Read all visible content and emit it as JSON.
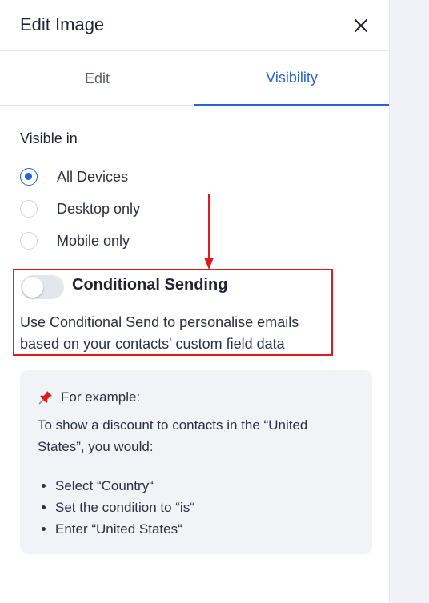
{
  "header": {
    "title": "Edit Image"
  },
  "tabs": [
    {
      "label": "Edit",
      "active": false
    },
    {
      "label": "Visibility",
      "active": true
    }
  ],
  "visibility": {
    "section_label": "Visible in",
    "options": [
      {
        "label": "All Devices",
        "selected": true
      },
      {
        "label": "Desktop only",
        "selected": false
      },
      {
        "label": "Mobile only",
        "selected": false
      }
    ]
  },
  "conditional": {
    "toggle_on": false,
    "title": "Conditional Sending",
    "description": "Use Conditional Send to personalise emails based on your contacts' custom field data"
  },
  "example": {
    "icon": "pushpin-icon",
    "heading": "For example:",
    "text": "To show a discount to contacts in the “United States”, you would:",
    "steps": [
      "Select “Country“",
      "Set the condition to “is“",
      "Enter “United States“"
    ]
  },
  "colors": {
    "accent": "#2563d6",
    "annotation_red": "#e0191f",
    "example_bg": "#f1f3f7",
    "right_pane_bg": "#f0f2f7"
  }
}
